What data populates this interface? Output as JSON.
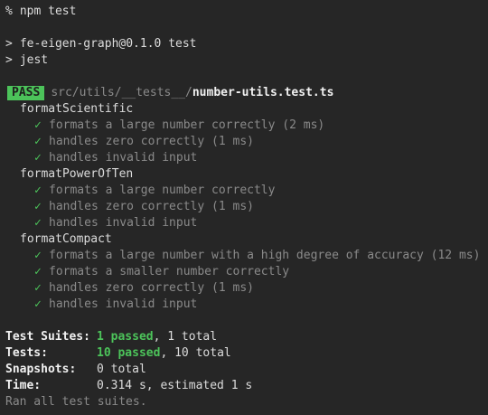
{
  "prompt": {
    "symbol": "%",
    "command": "npm test"
  },
  "script_output": {
    "marker": ">",
    "package_line": "fe-eigen-graph@0.1.0 test",
    "runner_line": "jest"
  },
  "result": {
    "badge": "PASS",
    "path_dir": "src/utils/__tests__/",
    "path_file": "number-utils.test.ts"
  },
  "groups": [
    {
      "name": "formatScientific",
      "tests": [
        {
          "check": "✓",
          "text": "formats a large number correctly (2 ms)"
        },
        {
          "check": "✓",
          "text": "handles zero correctly (1 ms)"
        },
        {
          "check": "✓",
          "text": "handles invalid input"
        }
      ]
    },
    {
      "name": "formatPowerOfTen",
      "tests": [
        {
          "check": "✓",
          "text": "formats a large number correctly"
        },
        {
          "check": "✓",
          "text": "handles zero correctly (1 ms)"
        },
        {
          "check": "✓",
          "text": "handles invalid input"
        }
      ]
    },
    {
      "name": "formatCompact",
      "tests": [
        {
          "check": "✓",
          "text": "formats a large number with a high degree of accuracy (12 ms)"
        },
        {
          "check": "✓",
          "text": "formats a smaller number correctly"
        },
        {
          "check": "✓",
          "text": "handles zero correctly (1 ms)"
        },
        {
          "check": "✓",
          "text": "handles invalid input"
        }
      ]
    }
  ],
  "summary": {
    "suites_label": "Test Suites:",
    "suites_passed": "1 passed",
    "suites_rest": ", 1 total",
    "tests_label": "Tests:",
    "tests_passed": "10 passed",
    "tests_rest": ", 10 total",
    "snapshots_label": "Snapshots:",
    "snapshots_value": "0 total",
    "time_label": "Time:",
    "time_value": "0.314 s, estimated 1 s",
    "footer": "Ran all test suites."
  },
  "colors": {
    "background": "#262626",
    "pass_green": "#4cc35a",
    "dim_text": "#8a8a8a"
  }
}
